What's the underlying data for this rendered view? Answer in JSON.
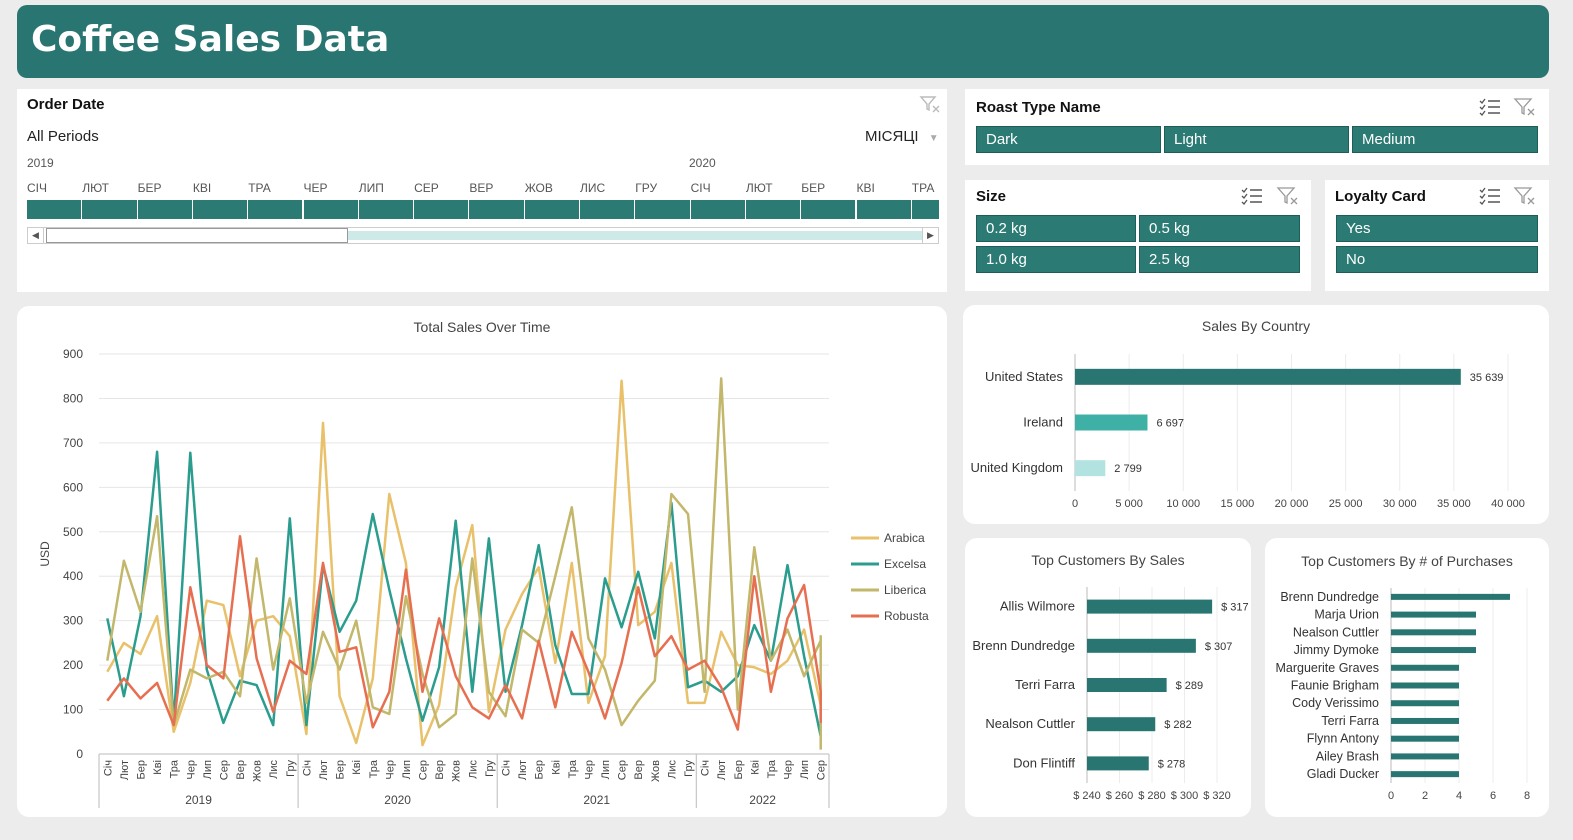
{
  "header": {
    "title": "Coffee Sales Data"
  },
  "timeline": {
    "title": "Order Date",
    "period_label": "All Periods",
    "level_label": "МІСЯЦІ",
    "years": [
      "2019",
      "2020"
    ],
    "months": [
      "СІЧ",
      "ЛЮТ",
      "БЕР",
      "КВІ",
      "ТРА",
      "ЧЕР",
      "ЛИП",
      "СЕР",
      "ВЕР",
      "ЖОВ",
      "ЛИС",
      "ГРУ",
      "СІЧ",
      "ЛЮТ",
      "БЕР",
      "КВІ",
      "ТРА"
    ]
  },
  "roast_slicer": {
    "title": "Roast Type Name",
    "items": [
      "Dark",
      "Light",
      "Medium"
    ]
  },
  "size_slicer": {
    "title": "Size",
    "items": [
      "0.2 kg",
      "0.5 kg",
      "1.0 kg",
      "2.5 kg"
    ]
  },
  "loyalty_slicer": {
    "title": "Loyalty Card",
    "items": [
      "Yes",
      "No"
    ]
  },
  "colors": {
    "brand": "#287571",
    "arabica": "#e8c16a",
    "excelsa": "#2a9d8f",
    "liberica": "#c2b76a",
    "robusta": "#e76f51"
  },
  "icons": {
    "multi_select": "multi-select-icon",
    "clear_filter": "clear-filter-icon"
  },
  "sales_over_time": {
    "title": "Total Sales Over Time",
    "chart_data": {
      "type": "line",
      "title": "Total Sales Over Time",
      "ylabel": "USD",
      "ylim": [
        0,
        900
      ],
      "yticks": [
        0,
        100,
        200,
        300,
        400,
        500,
        600,
        700,
        800,
        900
      ],
      "grid": true,
      "legend": "right",
      "month_labels": [
        "Січ",
        "Лют",
        "Бер",
        "Кві",
        "Тра",
        "Чер",
        "Лип",
        "Сер",
        "Вер",
        "Жов",
        "Лис",
        "Гру",
        "Січ",
        "Лют",
        "Бер",
        "Кві",
        "Тра",
        "Чер",
        "Лип",
        "Сер",
        "Вер",
        "Жов",
        "Лис",
        "Гру",
        "Січ",
        "Лют",
        "Бер",
        "Кві",
        "Тра",
        "Чер",
        "Лип",
        "Сер",
        "Вер",
        "Жов",
        "Лис",
        "Гру",
        "Січ",
        "Лют",
        "Бер",
        "Кві",
        "Тра",
        "Чер",
        "Лип",
        "Сер"
      ],
      "year_groups": [
        {
          "label": "2019",
          "count": 12
        },
        {
          "label": "2020",
          "count": 12
        },
        {
          "label": "2021",
          "count": 12
        },
        {
          "label": "2022",
          "count": 8
        }
      ],
      "series": [
        {
          "name": "Arabica",
          "values": [
            185,
            250,
            225,
            310,
            50,
            160,
            345,
            335,
            175,
            300,
            310,
            265,
            45,
            745,
            130,
            25,
            170,
            585,
            430,
            20,
            110,
            375,
            515,
            95,
            280,
            360,
            420,
            205,
            430,
            115,
            220,
            840,
            290,
            320,
            430,
            115,
            115,
            275,
            200,
            195,
            180,
            210,
            280,
            110
          ]
        },
        {
          "name": "Excelsa",
          "values": [
            305,
            130,
            310,
            680,
            70,
            678,
            190,
            70,
            165,
            155,
            65,
            530,
            65,
            425,
            275,
            345,
            540,
            370,
            215,
            75,
            195,
            525,
            140,
            485,
            140,
            290,
            470,
            245,
            135,
            135,
            395,
            285,
            410,
            260,
            565,
            150,
            165,
            140,
            175,
            290,
            210,
            425,
            220,
            40
          ]
        },
        {
          "name": "Liberica",
          "values": [
            210,
            435,
            320,
            535,
            65,
            190,
            170,
            185,
            130,
            440,
            190,
            350,
            115,
            275,
            190,
            300,
            105,
            90,
            355,
            180,
            60,
            90,
            440,
            140,
            85,
            280,
            250,
            400,
            555,
            260,
            190,
            65,
            120,
            165,
            585,
            540,
            140,
            845,
            100,
            465,
            210,
            280,
            175,
            255,
            265,
            10
          ]
        },
        {
          "name": "Robusta",
          "values": [
            120,
            170,
            125,
            160,
            65,
            375,
            200,
            170,
            490,
            215,
            95,
            210,
            180,
            430,
            230,
            240,
            60,
            140,
            415,
            140,
            305,
            175,
            105,
            80,
            155,
            80,
            255,
            105,
            275,
            185,
            80,
            205,
            375,
            220,
            265,
            190,
            210,
            150,
            55,
            400,
            140,
            305,
            380,
            140,
            70
          ]
        }
      ]
    }
  },
  "sales_by_country": {
    "title": "Sales By Country",
    "chart_data": {
      "type": "bar",
      "orientation": "horizontal",
      "title": "Sales By Country",
      "categories": [
        "United States",
        "Ireland",
        "United Kingdom"
      ],
      "values": [
        35639,
        6697,
        2799
      ],
      "value_labels": [
        "35 639",
        "6 697",
        "2 799"
      ],
      "xlim": [
        0,
        40000
      ],
      "xticks": [
        "0",
        "5 000",
        "10 000",
        "15 000",
        "20 000",
        "25 000",
        "30 000",
        "35 000",
        "40 000"
      ],
      "bar_colors": [
        "#287571",
        "#3fb0a6",
        "#b3e3e0"
      ]
    }
  },
  "top_customers_sales": {
    "title": "Top Customers By Sales",
    "chart_data": {
      "type": "bar",
      "orientation": "horizontal",
      "title": "Top Customers By Sales",
      "categories": [
        "Allis Wilmore",
        "Brenn Dundredge",
        "Terri Farra",
        "Nealson Cuttler",
        "Don Flintiff"
      ],
      "values": [
        317,
        307,
        289,
        282,
        278
      ],
      "value_labels": [
        "$ 317",
        "$ 307",
        "$ 289",
        "$ 282",
        "$ 278"
      ],
      "xlim": [
        240,
        320
      ],
      "xticks": [
        "$ 240",
        "$ 260",
        "$ 280",
        "$ 300",
        "$ 320"
      ]
    }
  },
  "top_customers_purchases": {
    "title": "Top Customers By # of Purchases",
    "chart_data": {
      "type": "bar",
      "orientation": "horizontal",
      "title": "Top Customers By # of Purchases",
      "categories": [
        "Brenn Dundredge",
        "Marja Urion",
        "Nealson Cuttler",
        "Jimmy Dymoke",
        "Marguerite Graves",
        "Faunie Brigham",
        "Cody Verissimo",
        "Terri Farra",
        "Flynn Antony",
        "Ailey Brash",
        "Gladi Ducker"
      ],
      "values": [
        7,
        5,
        5,
        5,
        4,
        4,
        4,
        4,
        4,
        4,
        4
      ],
      "xlim": [
        0,
        8
      ],
      "xticks": [
        "0",
        "2",
        "4",
        "6",
        "8"
      ]
    }
  }
}
